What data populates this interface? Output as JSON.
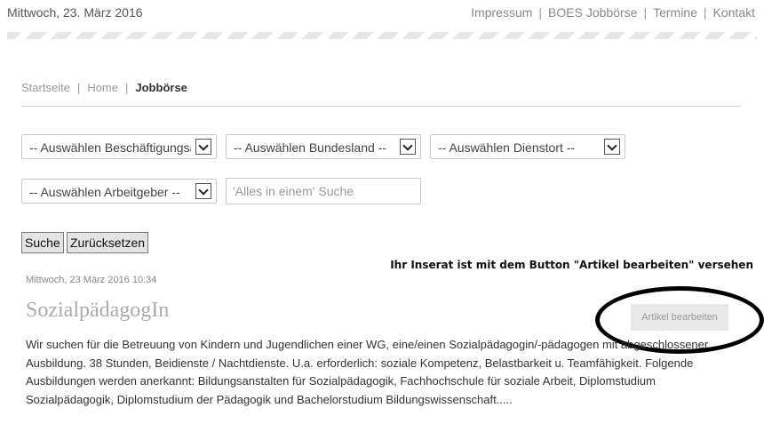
{
  "header": {
    "date": "Mittwoch, 23. März 2016",
    "nav": [
      "Impressum",
      "BOES Jobbörse",
      "Termine",
      "Kontakt"
    ]
  },
  "breadcrumb": [
    "Startseite",
    "Home",
    "Jobbörse"
  ],
  "filters": {
    "employment": "-- Auswählen Beschäftigungsart --",
    "state": "-- Auswählen Bundesland --",
    "location": "-- Auswählen Dienstort --",
    "employer": "-- Auswählen Arbeitgeber --",
    "search_placeholder": "'Alles in einem' Suche"
  },
  "buttons": {
    "search": "Suche",
    "reset": "Zurücksetzen"
  },
  "notice": "Ihr Inserat ist mit dem Button \"Artikel bearbeiten\" versehen",
  "post": {
    "date": "Mittwoch, 23 März 2016 10:34",
    "title": "SozialpädagogIn",
    "edit_label": "Artikel bearbeiten",
    "text": "Wir suchen für die Betreuung von Kindern und Jugendlichen einer WG, eine/einen Sozialpädagogin/-pädagogen mit abgeschlossener Ausbildung. 38 Stunden, Beidienste / Nachtdienste. U.a. erforderlich: soziale Kompetenz, Belastbarkeit u. Teamfähigkeit. Folgende Ausbildungen werden anerkannt: Bildungsanstalten für Sozialpädagogik, Fachhochschule für soziale Arbeit, Diplomstudium Sozialpädagogik, Diplomstudium der Pädagogik und Bachelorstudium Bildungswissenschaft....."
  }
}
